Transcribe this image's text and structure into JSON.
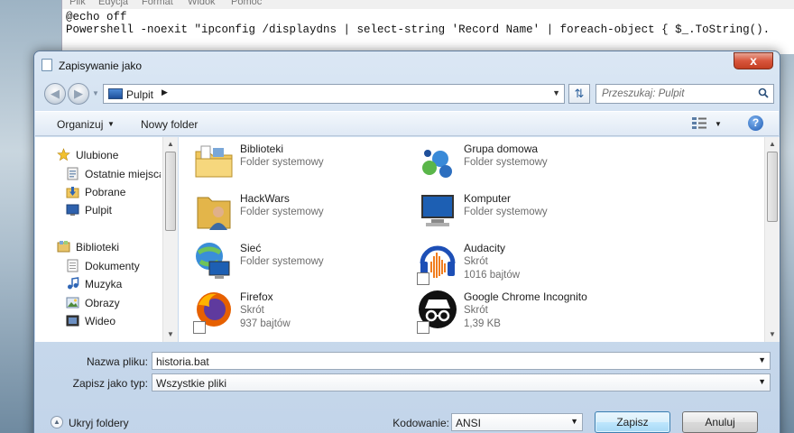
{
  "notepad": {
    "menu": [
      "Plik",
      "Edycja",
      "Format",
      "Widok",
      "Pomoc"
    ],
    "lines": [
      "@echo off",
      "Powershell -noexit \"ipconfig /displaydns | select-string 'Record Name' | foreach-object { $_.ToString()."
    ]
  },
  "dialog": {
    "title": "Zapisywanie jako",
    "close_label": "x",
    "address": {
      "location": "Pulpit"
    },
    "search": {
      "placeholder": "Przeszukaj: Pulpit"
    },
    "toolbar": {
      "organize": "Organizuj",
      "new_folder": "Nowy folder"
    },
    "nav": {
      "items": [
        {
          "label": "Ulubione",
          "icon": "star-icon"
        },
        {
          "label": "Ostatnie miejsca",
          "icon": "recent-places-icon"
        },
        {
          "label": "Pobrane",
          "icon": "downloads-icon"
        },
        {
          "label": "Pulpit",
          "icon": "desktop-icon"
        },
        {
          "label": "Biblioteki",
          "icon": "libraries-icon"
        },
        {
          "label": "Dokumenty",
          "icon": "documents-icon"
        },
        {
          "label": "Muzyka",
          "icon": "music-icon"
        },
        {
          "label": "Obrazy",
          "icon": "pictures-icon"
        },
        {
          "label": "Wideo",
          "icon": "video-icon"
        }
      ]
    },
    "files": [
      {
        "name": "Biblioteki",
        "type": "Folder systemowy",
        "icon": "libraries-folder-icon"
      },
      {
        "name": "Grupa domowa",
        "type": "Folder systemowy",
        "icon": "homegroup-icon"
      },
      {
        "name": "HackWars",
        "type": "Folder systemowy",
        "icon": "user-folder-icon"
      },
      {
        "name": "Komputer",
        "type": "Folder systemowy",
        "icon": "computer-icon"
      },
      {
        "name": "Sieć",
        "type": "Folder systemowy",
        "icon": "network-icon"
      },
      {
        "name": "Audacity",
        "type": "Skrót",
        "size": "1016 bajtów",
        "icon": "audacity-icon"
      },
      {
        "name": "Firefox",
        "type": "Skrót",
        "size": "937 bajtów",
        "icon": "firefox-icon"
      },
      {
        "name": "Google Chrome Incognito",
        "type": "Skrót",
        "size": "1,39 KB",
        "icon": "incognito-icon"
      }
    ],
    "filename": {
      "label": "Nazwa pliku:",
      "value": "historia.bat"
    },
    "filetype": {
      "label": "Zapisz jako typ:",
      "value": "Wszystkie pliki"
    },
    "hide_folders": "Ukryj foldery",
    "encoding": {
      "label": "Kodowanie:",
      "value": "ANSI"
    },
    "save": "Zapisz",
    "cancel": "Anuluj"
  }
}
